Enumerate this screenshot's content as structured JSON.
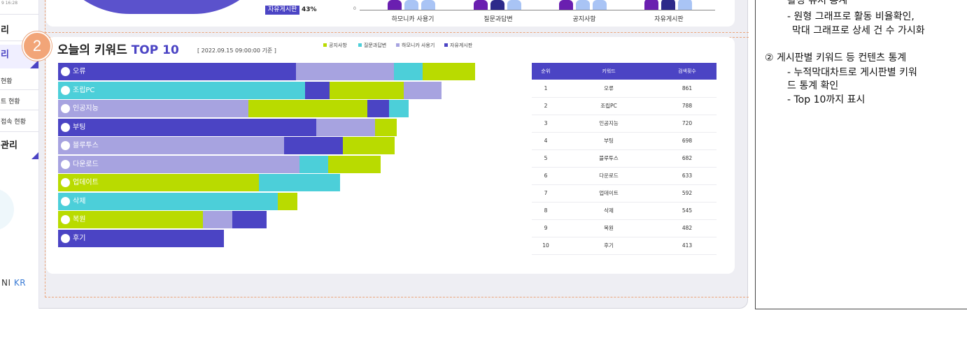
{
  "sidebar": {
    "timestamp": "9 16:28",
    "menu_top": "리",
    "menu_active": "리",
    "sub_items": [
      "현황",
      "트 현황",
      "접속 현황"
    ],
    "menu_bottom": "관리",
    "brand_prefix": "NI",
    "brand_suffix": "KR"
  },
  "top_section": {
    "pie_label": "자유게시판",
    "pie_percent": "43%",
    "axis_zero": "0",
    "categories": [
      "하모니카 사용기",
      "질문과답변",
      "공지사항",
      "자유게시판"
    ]
  },
  "keyword_section": {
    "badge": "2",
    "title_prefix": "오늘의 키워드 ",
    "title_highlight": "TOP 10",
    "timestamp": "[ 2022.09.15  09:00:00 기준 ]"
  },
  "chart_data": {
    "type": "bar",
    "orientation": "horizontal",
    "stacked": true,
    "categories": [
      "오류",
      "조립PC",
      "인공지능",
      "부팅",
      "블루투스",
      "다운로드",
      "업데이트",
      "삭제",
      "복원",
      "후기"
    ],
    "series": [
      {
        "name": "공지사항",
        "color": "#b9db00"
      },
      {
        "name": "질문과답변",
        "color": "#4ccfd9"
      },
      {
        "name": "하모니카 사용기",
        "color": "#a7a3e0"
      },
      {
        "name": "자유게시판",
        "color": "#4b44c4"
      }
    ],
    "rows": [
      {
        "label": "오류",
        "segments": [
          {
            "series": "자유게시판",
            "value": 340
          },
          {
            "series": "하모니카 사용기",
            "value": 140
          },
          {
            "series": "질문과답변",
            "value": 41
          },
          {
            "series": "공지사항",
            "value": 75
          }
        ]
      },
      {
        "label": "조립PC",
        "segments": [
          {
            "series": "질문과답변",
            "value": 353
          },
          {
            "series": "자유게시판",
            "value": 35
          },
          {
            "series": "공지사항",
            "value": 106
          },
          {
            "series": "하모니카 사용기",
            "value": 54
          }
        ]
      },
      {
        "label": "인공지능",
        "segments": [
          {
            "series": "하모니카 사용기",
            "value": 272
          },
          {
            "series": "공지사항",
            "value": 170
          },
          {
            "series": "자유게시판",
            "value": 31
          },
          {
            "series": "질문과답변",
            "value": 28
          }
        ]
      },
      {
        "label": "부팅",
        "segments": [
          {
            "series": "자유게시판",
            "value": 369
          },
          {
            "series": "하모니카 사용기",
            "value": 84
          },
          {
            "series": "공지사항",
            "value": 31
          }
        ]
      },
      {
        "label": "블루투스",
        "segments": [
          {
            "series": "하모니카 사용기",
            "value": 323
          },
          {
            "series": "자유게시판",
            "value": 84
          },
          {
            "series": "공지사항",
            "value": 74
          }
        ]
      },
      {
        "label": "다운로드",
        "segments": [
          {
            "series": "하모니카 사용기",
            "value": 345
          },
          {
            "series": "질문과답변",
            "value": 41
          },
          {
            "series": "공지사항",
            "value": 75
          }
        ]
      },
      {
        "label": "업데이트",
        "segments": [
          {
            "series": "공지사항",
            "value": 287
          },
          {
            "series": "질문과답변",
            "value": 116
          }
        ]
      },
      {
        "label": "삭제",
        "segments": [
          {
            "series": "질문과답변",
            "value": 314
          },
          {
            "series": "공지사항",
            "value": 28
          }
        ]
      },
      {
        "label": "복원",
        "segments": [
          {
            "series": "공지사항",
            "value": 207
          },
          {
            "series": "하모니카 사용기",
            "value": 42
          },
          {
            "series": "자유게시판",
            "value": 49
          }
        ]
      },
      {
        "label": "후기",
        "segments": [
          {
            "series": "자유게시판",
            "value": 237
          }
        ]
      }
    ]
  },
  "ranking_table": {
    "headers": [
      "순위",
      "키워드",
      "검색횟수"
    ],
    "rows": [
      [
        "1",
        "오류",
        "861"
      ],
      [
        "2",
        "조립PC",
        "788"
      ],
      [
        "3",
        "인공지능",
        "720"
      ],
      [
        "4",
        "부팅",
        "698"
      ],
      [
        "5",
        "블루투스",
        "682"
      ],
      [
        "6",
        "다운로드",
        "633"
      ],
      [
        "7",
        "업데이트",
        "592"
      ],
      [
        "8",
        "삭제",
        "545"
      ],
      [
        "9",
        "복원",
        "482"
      ],
      [
        "10",
        "후기",
        "413"
      ]
    ]
  },
  "description": {
    "lines": [
      "활성 유저 통계",
      "- 원형 그래프로 활동 비율확인,",
      "막대 그래프로 상세 건 수 가시화",
      "②  게시판별 키워드 등 컨텐츠 통계",
      "- 누적막대차트로 게시판별 키워",
      "드 통계 확인",
      "- Top 10까지 표시"
    ]
  }
}
